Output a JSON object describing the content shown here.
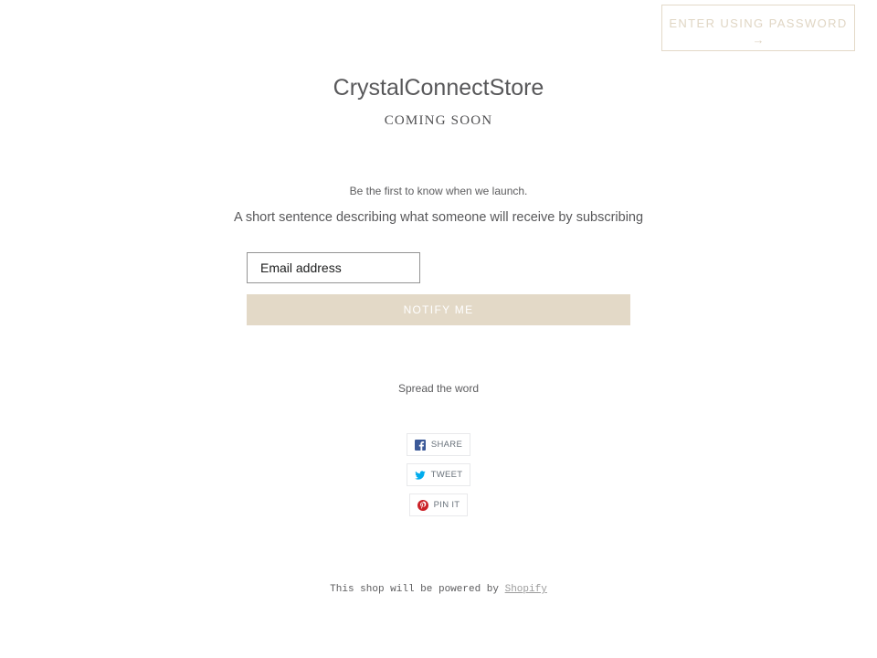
{
  "header": {
    "password_label": "Enter using password",
    "password_arrow": "→"
  },
  "hero": {
    "store_name": "CrystalConnectStore",
    "status": "Coming soon"
  },
  "newsletter": {
    "tagline": "Be the first to know when we launch.",
    "description": "A short sentence describing what someone will receive by subscribing",
    "email_placeholder": "Email address",
    "submit_label": "Notify me"
  },
  "share": {
    "heading": "Spread the word",
    "buttons": [
      {
        "label": "Share",
        "icon": "facebook-icon",
        "color": "#3b5998"
      },
      {
        "label": "Tweet",
        "icon": "twitter-icon",
        "color": "#00aced"
      },
      {
        "label": "Pin it",
        "icon": "pinterest-icon",
        "color": "#cb2127"
      }
    ]
  },
  "footer": {
    "powered_text": "This shop will be powered by",
    "powered_link": "Shopify"
  }
}
